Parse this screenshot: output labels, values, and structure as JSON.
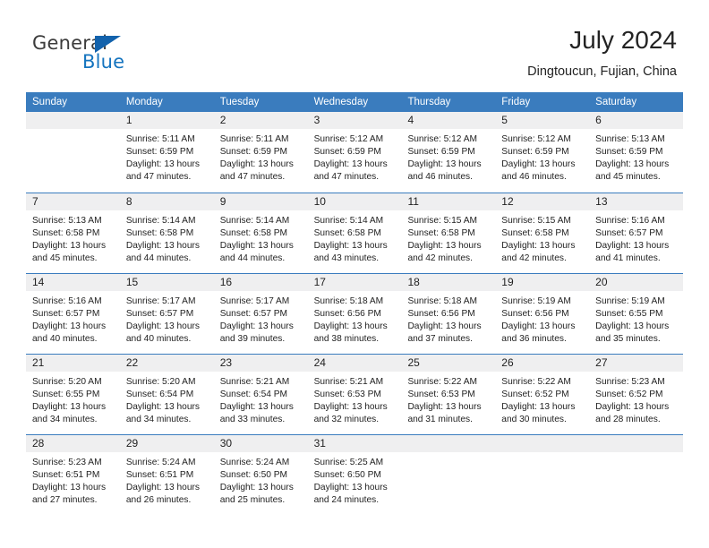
{
  "logo": {
    "word_one": "General",
    "word_two": "Blue",
    "triangle_icon": "blue-triangle-icon",
    "accent_dark": "#3b3b3b",
    "accent_blue": "#1574bf"
  },
  "header": {
    "title": "July 2024",
    "subtitle": "Dingtoucun, Fujian, China"
  },
  "colors": {
    "header_bar": "#3a7cbe",
    "day_band": "#efeff0",
    "row_divider": "#3a7cbe",
    "text": "#1f1f1f"
  },
  "weekdays": [
    "Sunday",
    "Monday",
    "Tuesday",
    "Wednesday",
    "Thursday",
    "Friday",
    "Saturday"
  ],
  "weeks": [
    {
      "days": [
        {
          "num": "",
          "lines": []
        },
        {
          "num": "1",
          "lines": [
            "Sunrise: 5:11 AM",
            "Sunset: 6:59 PM",
            "Daylight: 13 hours",
            "and 47 minutes."
          ]
        },
        {
          "num": "2",
          "lines": [
            "Sunrise: 5:11 AM",
            "Sunset: 6:59 PM",
            "Daylight: 13 hours",
            "and 47 minutes."
          ]
        },
        {
          "num": "3",
          "lines": [
            "Sunrise: 5:12 AM",
            "Sunset: 6:59 PM",
            "Daylight: 13 hours",
            "and 47 minutes."
          ]
        },
        {
          "num": "4",
          "lines": [
            "Sunrise: 5:12 AM",
            "Sunset: 6:59 PM",
            "Daylight: 13 hours",
            "and 46 minutes."
          ]
        },
        {
          "num": "5",
          "lines": [
            "Sunrise: 5:12 AM",
            "Sunset: 6:59 PM",
            "Daylight: 13 hours",
            "and 46 minutes."
          ]
        },
        {
          "num": "6",
          "lines": [
            "Sunrise: 5:13 AM",
            "Sunset: 6:59 PM",
            "Daylight: 13 hours",
            "and 45 minutes."
          ]
        }
      ]
    },
    {
      "days": [
        {
          "num": "7",
          "lines": [
            "Sunrise: 5:13 AM",
            "Sunset: 6:58 PM",
            "Daylight: 13 hours",
            "and 45 minutes."
          ]
        },
        {
          "num": "8",
          "lines": [
            "Sunrise: 5:14 AM",
            "Sunset: 6:58 PM",
            "Daylight: 13 hours",
            "and 44 minutes."
          ]
        },
        {
          "num": "9",
          "lines": [
            "Sunrise: 5:14 AM",
            "Sunset: 6:58 PM",
            "Daylight: 13 hours",
            "and 44 minutes."
          ]
        },
        {
          "num": "10",
          "lines": [
            "Sunrise: 5:14 AM",
            "Sunset: 6:58 PM",
            "Daylight: 13 hours",
            "and 43 minutes."
          ]
        },
        {
          "num": "11",
          "lines": [
            "Sunrise: 5:15 AM",
            "Sunset: 6:58 PM",
            "Daylight: 13 hours",
            "and 42 minutes."
          ]
        },
        {
          "num": "12",
          "lines": [
            "Sunrise: 5:15 AM",
            "Sunset: 6:58 PM",
            "Daylight: 13 hours",
            "and 42 minutes."
          ]
        },
        {
          "num": "13",
          "lines": [
            "Sunrise: 5:16 AM",
            "Sunset: 6:57 PM",
            "Daylight: 13 hours",
            "and 41 minutes."
          ]
        }
      ]
    },
    {
      "days": [
        {
          "num": "14",
          "lines": [
            "Sunrise: 5:16 AM",
            "Sunset: 6:57 PM",
            "Daylight: 13 hours",
            "and 40 minutes."
          ]
        },
        {
          "num": "15",
          "lines": [
            "Sunrise: 5:17 AM",
            "Sunset: 6:57 PM",
            "Daylight: 13 hours",
            "and 40 minutes."
          ]
        },
        {
          "num": "16",
          "lines": [
            "Sunrise: 5:17 AM",
            "Sunset: 6:57 PM",
            "Daylight: 13 hours",
            "and 39 minutes."
          ]
        },
        {
          "num": "17",
          "lines": [
            "Sunrise: 5:18 AM",
            "Sunset: 6:56 PM",
            "Daylight: 13 hours",
            "and 38 minutes."
          ]
        },
        {
          "num": "18",
          "lines": [
            "Sunrise: 5:18 AM",
            "Sunset: 6:56 PM",
            "Daylight: 13 hours",
            "and 37 minutes."
          ]
        },
        {
          "num": "19",
          "lines": [
            "Sunrise: 5:19 AM",
            "Sunset: 6:56 PM",
            "Daylight: 13 hours",
            "and 36 minutes."
          ]
        },
        {
          "num": "20",
          "lines": [
            "Sunrise: 5:19 AM",
            "Sunset: 6:55 PM",
            "Daylight: 13 hours",
            "and 35 minutes."
          ]
        }
      ]
    },
    {
      "days": [
        {
          "num": "21",
          "lines": [
            "Sunrise: 5:20 AM",
            "Sunset: 6:55 PM",
            "Daylight: 13 hours",
            "and 34 minutes."
          ]
        },
        {
          "num": "22",
          "lines": [
            "Sunrise: 5:20 AM",
            "Sunset: 6:54 PM",
            "Daylight: 13 hours",
            "and 34 minutes."
          ]
        },
        {
          "num": "23",
          "lines": [
            "Sunrise: 5:21 AM",
            "Sunset: 6:54 PM",
            "Daylight: 13 hours",
            "and 33 minutes."
          ]
        },
        {
          "num": "24",
          "lines": [
            "Sunrise: 5:21 AM",
            "Sunset: 6:53 PM",
            "Daylight: 13 hours",
            "and 32 minutes."
          ]
        },
        {
          "num": "25",
          "lines": [
            "Sunrise: 5:22 AM",
            "Sunset: 6:53 PM",
            "Daylight: 13 hours",
            "and 31 minutes."
          ]
        },
        {
          "num": "26",
          "lines": [
            "Sunrise: 5:22 AM",
            "Sunset: 6:52 PM",
            "Daylight: 13 hours",
            "and 30 minutes."
          ]
        },
        {
          "num": "27",
          "lines": [
            "Sunrise: 5:23 AM",
            "Sunset: 6:52 PM",
            "Daylight: 13 hours",
            "and 28 minutes."
          ]
        }
      ]
    },
    {
      "days": [
        {
          "num": "28",
          "lines": [
            "Sunrise: 5:23 AM",
            "Sunset: 6:51 PM",
            "Daylight: 13 hours",
            "and 27 minutes."
          ]
        },
        {
          "num": "29",
          "lines": [
            "Sunrise: 5:24 AM",
            "Sunset: 6:51 PM",
            "Daylight: 13 hours",
            "and 26 minutes."
          ]
        },
        {
          "num": "30",
          "lines": [
            "Sunrise: 5:24 AM",
            "Sunset: 6:50 PM",
            "Daylight: 13 hours",
            "and 25 minutes."
          ]
        },
        {
          "num": "31",
          "lines": [
            "Sunrise: 5:25 AM",
            "Sunset: 6:50 PM",
            "Daylight: 13 hours",
            "and 24 minutes."
          ]
        },
        {
          "num": "",
          "lines": []
        },
        {
          "num": "",
          "lines": []
        },
        {
          "num": "",
          "lines": []
        }
      ]
    }
  ]
}
